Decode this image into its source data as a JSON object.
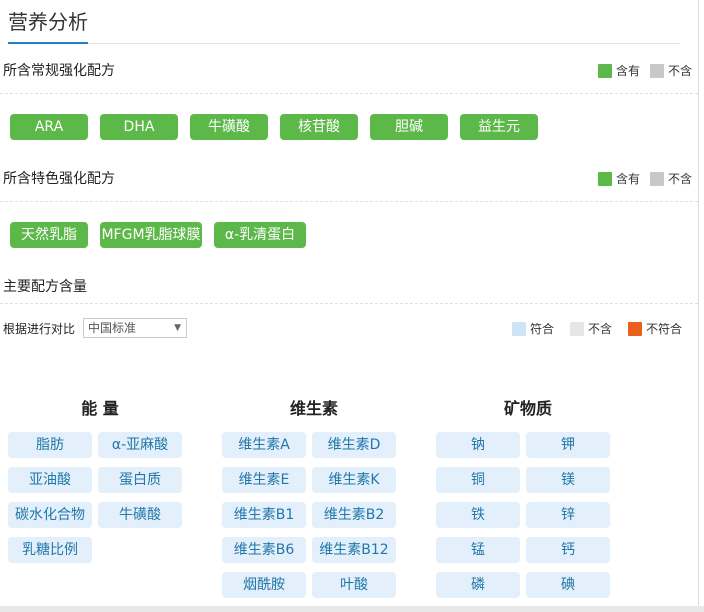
{
  "title": "营养分析",
  "regular": {
    "heading": "所含常规强化配方",
    "legend": {
      "yes": "含有",
      "no": "不含"
    },
    "items": [
      "ARA",
      "DHA",
      "牛磺酸",
      "核苷酸",
      "胆碱",
      "益生元"
    ]
  },
  "special": {
    "heading": "所含特色强化配方",
    "legend": {
      "yes": "含有",
      "no": "不含"
    },
    "items": [
      "天然乳脂",
      "MFGM乳脂球膜",
      "α-乳清蛋白"
    ]
  },
  "main": {
    "heading": "主要配方含量",
    "compare_label": "根据进行对比",
    "standard": "中国标准",
    "legend": {
      "ok": "符合",
      "none": "不含",
      "bad": "不符合"
    },
    "colors": {
      "ok": "#cfe3f7",
      "none": "#e6e6e6",
      "bad": "#e8601c",
      "has": "#5cb848",
      "hasnot": "#c8c8c8"
    },
    "energy": {
      "heading": "能 量",
      "items": [
        "脂肪",
        "α-亚麻酸",
        "亚油酸",
        "蛋白质",
        "碳水化合物",
        "牛磺酸",
        "乳糖比例"
      ]
    },
    "vitamins": {
      "heading": "维生素",
      "items": [
        "维生素A",
        "维生素D",
        "维生素E",
        "维生素K",
        "维生素B1",
        "维生素B2",
        "维生素B6",
        "维生素B12",
        "烟酰胺",
        "叶酸"
      ]
    },
    "minerals": {
      "heading": "矿物质",
      "items": [
        "钠",
        "钾",
        "铜",
        "镁",
        "铁",
        "锌",
        "锰",
        "钙",
        "磷",
        "碘"
      ]
    }
  }
}
